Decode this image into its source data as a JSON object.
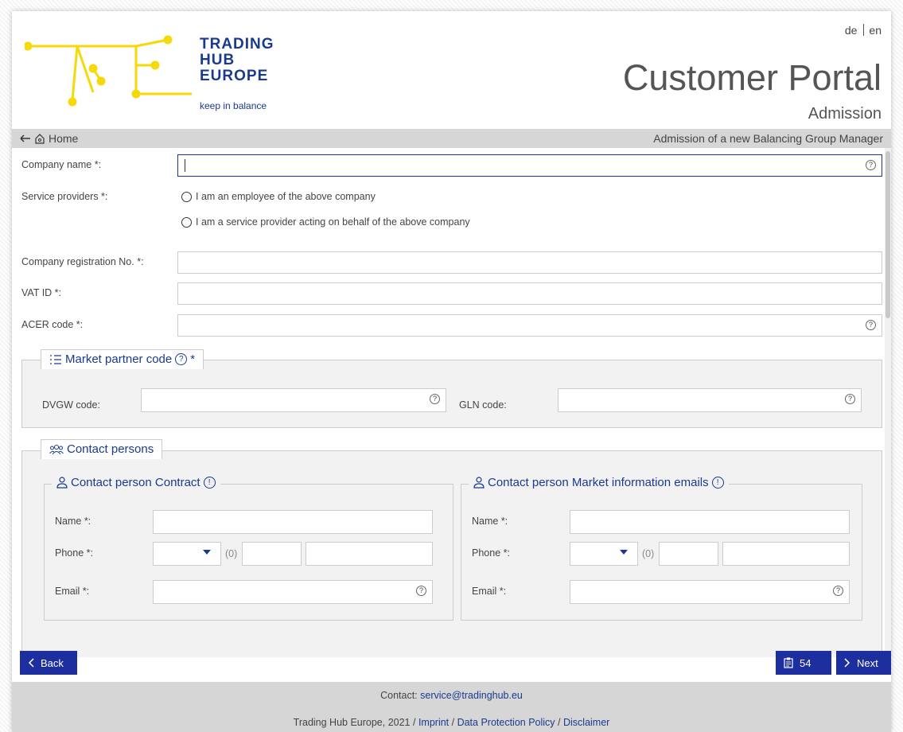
{
  "header": {
    "logo_lines": [
      "TRADING",
      "HUB",
      "EUROPE"
    ],
    "logo_tagline": "keep in balance",
    "lang_de": "de",
    "lang_en": "en",
    "portal_title": "Customer Portal",
    "portal_subtitle": "Admission"
  },
  "navbar": {
    "home_label": "Home",
    "page_context": "Admission of a new Balancing Group Manager"
  },
  "form": {
    "company_name_label": "Company name *:",
    "service_providers_label": "Service providers *:",
    "radio_employee": "I am an employee of the above company",
    "radio_service_provider": "I am a service provider acting on behalf of the above company",
    "company_reg_label": "Company registration No. *:",
    "vat_label": "VAT ID *:",
    "acer_label": "ACER code *:",
    "market_partner_legend": "Market partner code",
    "market_partner_required": "*",
    "dvgw_label": "DVGW code:",
    "gln_label": "GLN code:",
    "contact_persons_legend": "Contact persons",
    "contract": {
      "legend": "Contact person Contract",
      "name_label": "Name *:",
      "phone_label": "Phone *:",
      "zero": "(0)",
      "email_label": "Email *:"
    },
    "market_info": {
      "legend": "Contact person Market information emails",
      "name_label": "Name *:",
      "phone_label": "Phone *:",
      "zero": "(0)",
      "email_label": "Email *:"
    }
  },
  "buttons": {
    "back": "Back",
    "count": "54",
    "next": "Next"
  },
  "footer": {
    "contact_prefix": "Contact:",
    "contact_email": "service@tradinghub.eu",
    "copyright": "Trading Hub Europe, 2021 /",
    "imprint": "Imprint",
    "data_protection": "Data Protection Policy",
    "disclaimer": "Disclaimer"
  },
  "colors": {
    "brand_blue": "#1a3a8f",
    "button_blue": "#1d2f9f",
    "logo_yellow": "#f5d90a"
  }
}
